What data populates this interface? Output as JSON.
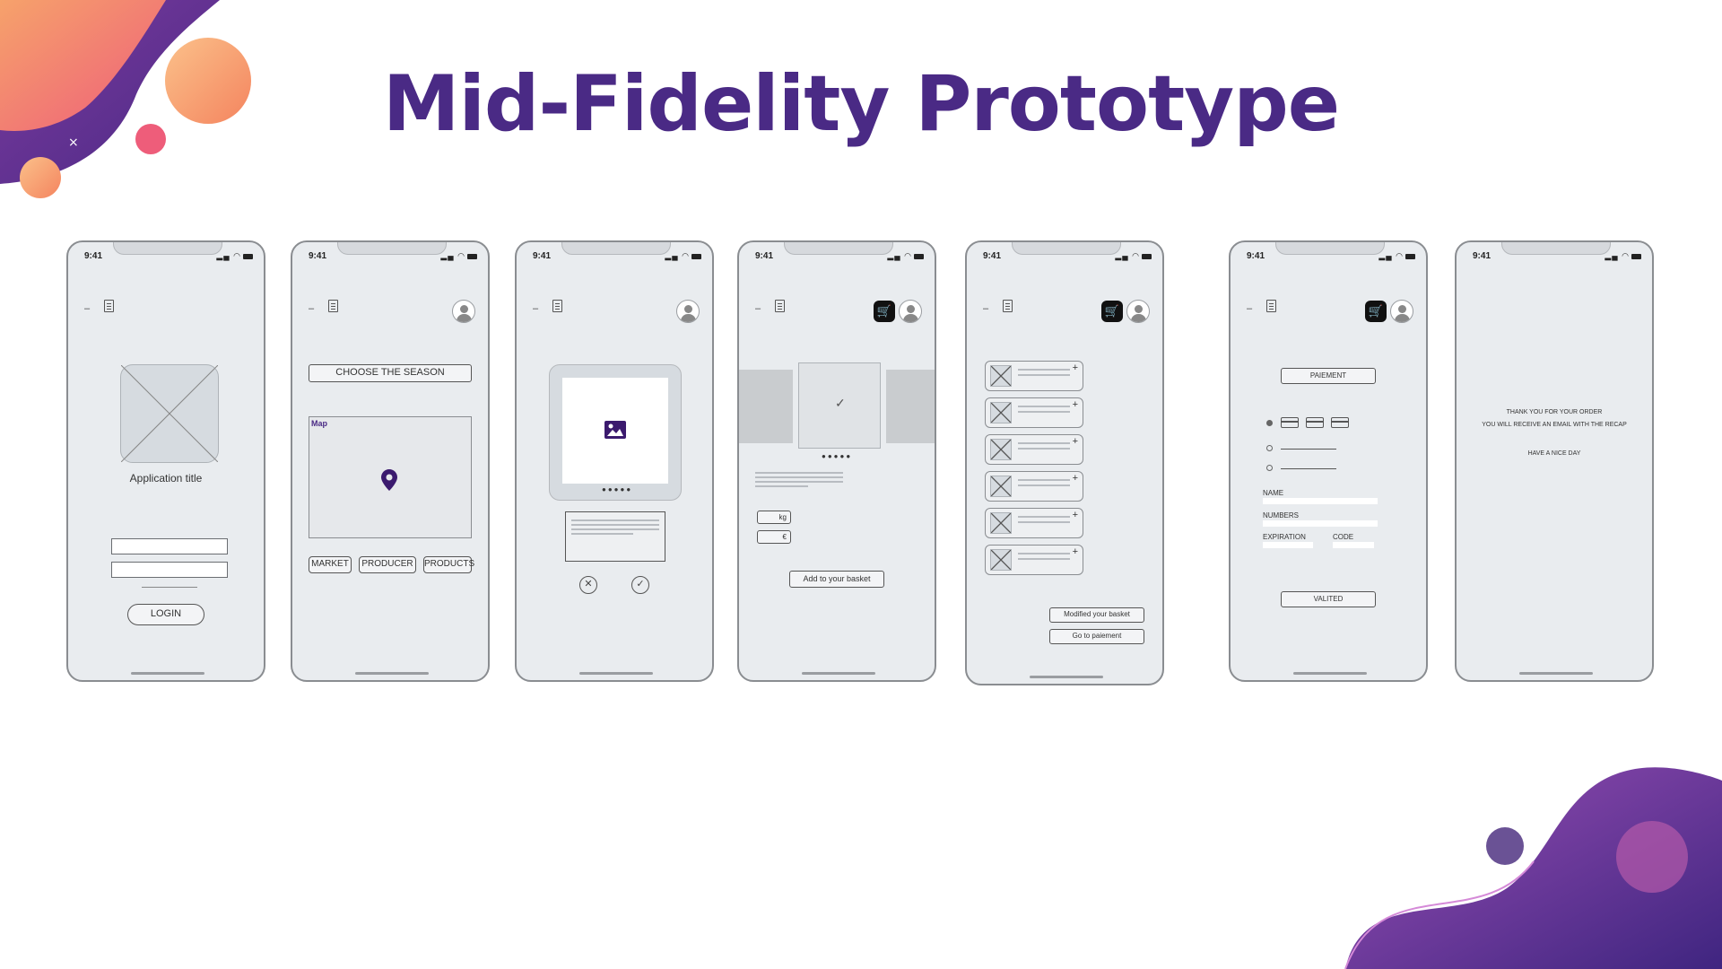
{
  "slide": {
    "title": "Mid-Fidelity Prototype",
    "colors": {
      "title": "#4a2a85",
      "accent_purple": "#5b2c91",
      "accent_orange": "#f4845f",
      "accent_pink": "#ee5d7a"
    }
  },
  "status_bar": {
    "time": "9:41",
    "icons": "signal wifi battery"
  },
  "screens": {
    "login": {
      "app_title": "Application title",
      "login_label": "LOGIN"
    },
    "season": {
      "choose_label": "CHOOSE THE SEASON",
      "map_label": "Map",
      "tabs": [
        "MARKET",
        "PRODUCER",
        "PRODUCTS"
      ]
    },
    "swipe": {
      "reject_icon": "close-icon",
      "accept_icon": "check-icon"
    },
    "product": {
      "unit_kg": "kg",
      "unit_currency": "€",
      "add_label": "Add to your basket"
    },
    "basket": {
      "modify_label": "Modified your basket",
      "go_label": "Go to paiement",
      "item_count": 6
    },
    "payment": {
      "title_label": "PAIEMENT",
      "name_label": "NAME",
      "numbers_label": "NUMBERS",
      "expiration_label": "EXPIRATION",
      "code_label": "CODE",
      "validate_label": "VALITED"
    },
    "thanks": {
      "line1": "THANK YOU FOR YOUR ORDER",
      "line2": "YOU WILL RECEIVE AN EMAIL WITH THE RECAP",
      "line3": "HAVE A NICE DAY"
    }
  }
}
